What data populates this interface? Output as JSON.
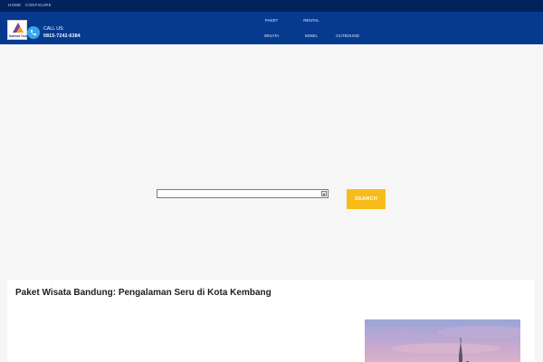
{
  "topbar": {
    "links": [
      "HOME",
      "CONFIGURE"
    ]
  },
  "header": {
    "logo_text": "Kalimat Tour",
    "call_label": "CALL US:",
    "call_number": "0815-7242-6384",
    "nav": [
      {
        "label_top": "PAKET",
        "label_bottom": "WISATA"
      },
      {
        "label_top": "RENTAL",
        "label_bottom": "MOBIL"
      },
      {
        "label_bottom": "OUTBOUND"
      }
    ]
  },
  "search": {
    "select_value": "",
    "button_label": "SEARCH"
  },
  "article": {
    "title": "Paket Wisata Bandung: Pengalaman Seru di Kota Kembang"
  },
  "colors": {
    "topbar": "#01215c",
    "header": "#053a8f",
    "accent": "#f8bc1a",
    "phone_icon": "#33a6f0"
  },
  "icons": {
    "phone": "phone-icon",
    "select_arrow": "chevron-down-icon"
  }
}
